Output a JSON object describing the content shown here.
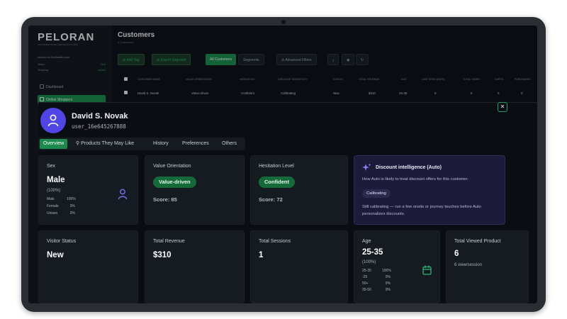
{
  "app": {
    "logo": "PELORAN",
    "logo_sub": "CUSTOMER INTELLIGENCE PLATFORM",
    "account": "search-for-feelhealth.com",
    "sidebar_rows": [
      {
        "label": "Team",
        "value": "N/A"
      },
      {
        "label": "Tracking",
        "value": "active"
      }
    ],
    "nav": [
      {
        "label": "Dashboard",
        "active": false
      },
      {
        "label": "Online Shoppers",
        "active": true
      }
    ]
  },
  "page": {
    "title": "Customers",
    "subtitle": "0 Customers",
    "toolbar": {
      "add_tag": "Add Tag",
      "export_segment": "Export Segment",
      "all_customers": "All Customers",
      "segments": "Segments",
      "advanced_filters": "Advanced Filters"
    },
    "table": {
      "headers": [
        "Customer Name",
        "Value Orientation",
        "Hesitation",
        "Discount Sensitivity",
        "Status",
        "Total Revenue",
        "Age",
        "Last Seen (days)",
        "Total Views",
        "Carts",
        "Purchases"
      ],
      "row": [
        "David S. Novak",
        "Value-driven",
        "Confident",
        "Calibrating",
        "New",
        "$310",
        "25-35",
        "0",
        "6",
        "0",
        "0"
      ]
    }
  },
  "customer": {
    "name": "David S. Novak",
    "id": "user_16e645267888",
    "close_label": "✕"
  },
  "tabs": [
    "Overview",
    "Products They May Like",
    "History",
    "Preferences",
    "Others"
  ],
  "cards": {
    "sex": {
      "label": "Sex",
      "value": "Male",
      "pct": "(100%)",
      "breakdown": [
        {
          "k": "Male",
          "v": "100%"
        },
        {
          "k": "Female",
          "v": "0%"
        },
        {
          "k": "Unisex",
          "v": "0%"
        }
      ]
    },
    "value_orientation": {
      "label": "Value Orientation",
      "pill": "Value-driven",
      "score": "Score: 85"
    },
    "hesitation": {
      "label": "Hesitation Level",
      "pill": "Confident",
      "score": "Score: 72"
    },
    "discount": {
      "title": "Discount intelligence (Auto)",
      "desc": "How Auto is likely to treat discount offers for this customer.",
      "tag": "Calibrating",
      "note": "Still calibrating — run a few onsite or journey touches before Auto personalizes discounts."
    },
    "visitor_status": {
      "label": "Visitor Status",
      "value": "New"
    },
    "total_revenue": {
      "label": "Total Revenue",
      "value": "$310"
    },
    "total_sessions": {
      "label": "Total Sessions",
      "value": "1"
    },
    "age": {
      "label": "Age",
      "value": "25-35",
      "pct": "(100%)",
      "breakdown": [
        {
          "k": "25-35",
          "v": "100%"
        },
        {
          "k": "-25",
          "v": "0%"
        },
        {
          "k": "50+",
          "v": "0%"
        },
        {
          "k": "35-50",
          "v": "0%"
        }
      ]
    },
    "viewed": {
      "label": "Total Viewed Product",
      "value": "6",
      "sub": "6 view/session"
    }
  },
  "colors": {
    "accent": "#1b8a4c",
    "avatar": "#4f46e5",
    "intel_bg": "#1c1b3a"
  }
}
